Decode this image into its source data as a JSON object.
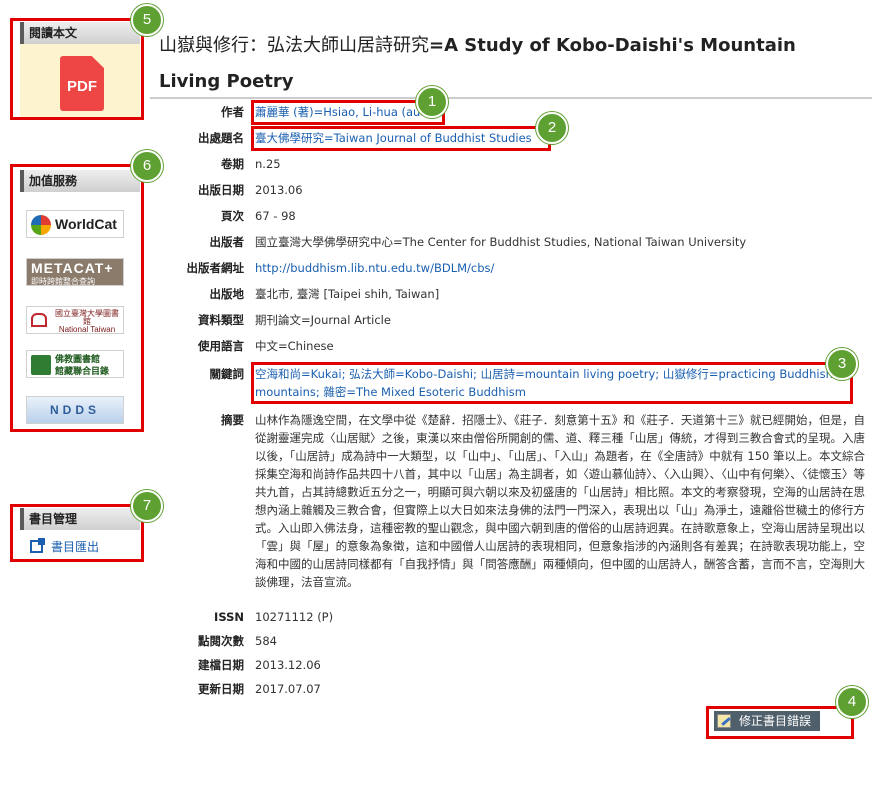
{
  "sidebar": {
    "read": {
      "header": "閱讀本文",
      "pdf_label": "PDF"
    },
    "services": {
      "header": "加值服務",
      "items": [
        {
          "label": "WorldCat"
        },
        {
          "label": "METACAT+",
          "sub": "即時跨館整合查詢"
        },
        {
          "label": "國立臺灣大學圖書館",
          "sub": "National Taiwan University Library"
        },
        {
          "label": "佛教圖書館",
          "sub": "館藏聯合目錄"
        },
        {
          "label": "NDDS"
        }
      ]
    },
    "bib": {
      "header": "書目管理",
      "export_label": "書目匯出"
    }
  },
  "record": {
    "title_zh": "山嶽與修行：弘法大師山居詩研究",
    "title_en": "=A Study of Kobo-Daishi's Mountain Living Poetry",
    "fields": {
      "author": {
        "label": "作者",
        "value": "蕭麗華 (著)=Hsiao, Li-hua (au.)"
      },
      "source": {
        "label": "出處題名",
        "value": "臺大佛學研究=Taiwan Journal of Buddhist Studies"
      },
      "volume": {
        "label": "卷期",
        "value": "n.25"
      },
      "pub_date": {
        "label": "出版日期",
        "value": "2013.06"
      },
      "pages": {
        "label": "頁次",
        "value": "67 - 98"
      },
      "publisher": {
        "label": "出版者",
        "value": "國立臺灣大學佛學研究中心=The Center for Buddhist Studies, National Taiwan University"
      },
      "publisher_url": {
        "label": "出版者網址",
        "value": "http://buddhism.lib.ntu.edu.tw/BDLM/cbs/"
      },
      "place": {
        "label": "出版地",
        "value": "臺北市, 臺灣 [Taipei shih, Taiwan]"
      },
      "doc_type": {
        "label": "資料類型",
        "value": "期刊論文=Journal Article"
      },
      "language": {
        "label": "使用語言",
        "value": "中文=Chinese"
      },
      "keywords": {
        "label": "關鍵詞",
        "value": "空海和尚=Kukai; 弘法大師=Kobo-Daishi; 山居詩=mountain living poetry; 山嶽修行=practicing Buddhism in mountains; 雜密=The Mixed Esoteric Buddhism"
      },
      "abstract": {
        "label": "摘要",
        "value": "山林作為隱逸空間，在文學中從《楚辭．招隱士》、《莊子．刻意第十五》和《莊子．天道第十三》就已經開始，但是，自從謝靈運完成〈山居賦〉之後，東漢以來由僧俗所開創的儒、道、釋三種「山居」傳統，才得到三教合會式的呈現。入唐以後，「山居詩」成為詩中一大類型，以「山中」、「山居」、「入山」為題者，在《全唐詩》中就有 150 筆以上。本文綜合採集空海和尚詩作品共四十八首，其中以「山居」為主調者，如〈遊山慕仙詩〉、〈入山興〉、〈山中有何樂〉、〈徒懷玉〉等共九首，占其詩總數近五分之一，明顯可與六朝以來及初盛唐的「山居詩」相比照。本文的考察發現，空海的山居詩在思想內涵上雜觸及三教合會，但實際上以大日如來法身佛的法門一門深入，表現出以「山」為淨土，遠離俗世穢土的修行方式。入山即入佛法身，這種密教的聖山觀念，與中國六朝到唐的僧俗的山居詩迥異。在詩歌意象上，空海山居詩呈現出以「雲」與「屋」的意象為象徵，這和中國僧人山居詩的表現相同，但意象指涉的內涵則各有差異；在詩歌表現功能上，空海和中國的山居詩同樣都有「自我抒情」與「問答應酬」兩種傾向，但中國的山居詩人，酬答含蓄，言而不言，空海則大談佛理，法音宣流。"
      },
      "issn": {
        "label": "ISSN",
        "value": "10271112 (P)"
      },
      "views": {
        "label": "點閱次數",
        "value": "584"
      },
      "created": {
        "label": "建檔日期",
        "value": "2013.12.06"
      },
      "updated": {
        "label": "更新日期",
        "value": "2017.07.07"
      }
    },
    "fix_button": "修正書目錯誤"
  },
  "annotations": [
    "1",
    "2",
    "3",
    "4",
    "5",
    "6",
    "7"
  ]
}
